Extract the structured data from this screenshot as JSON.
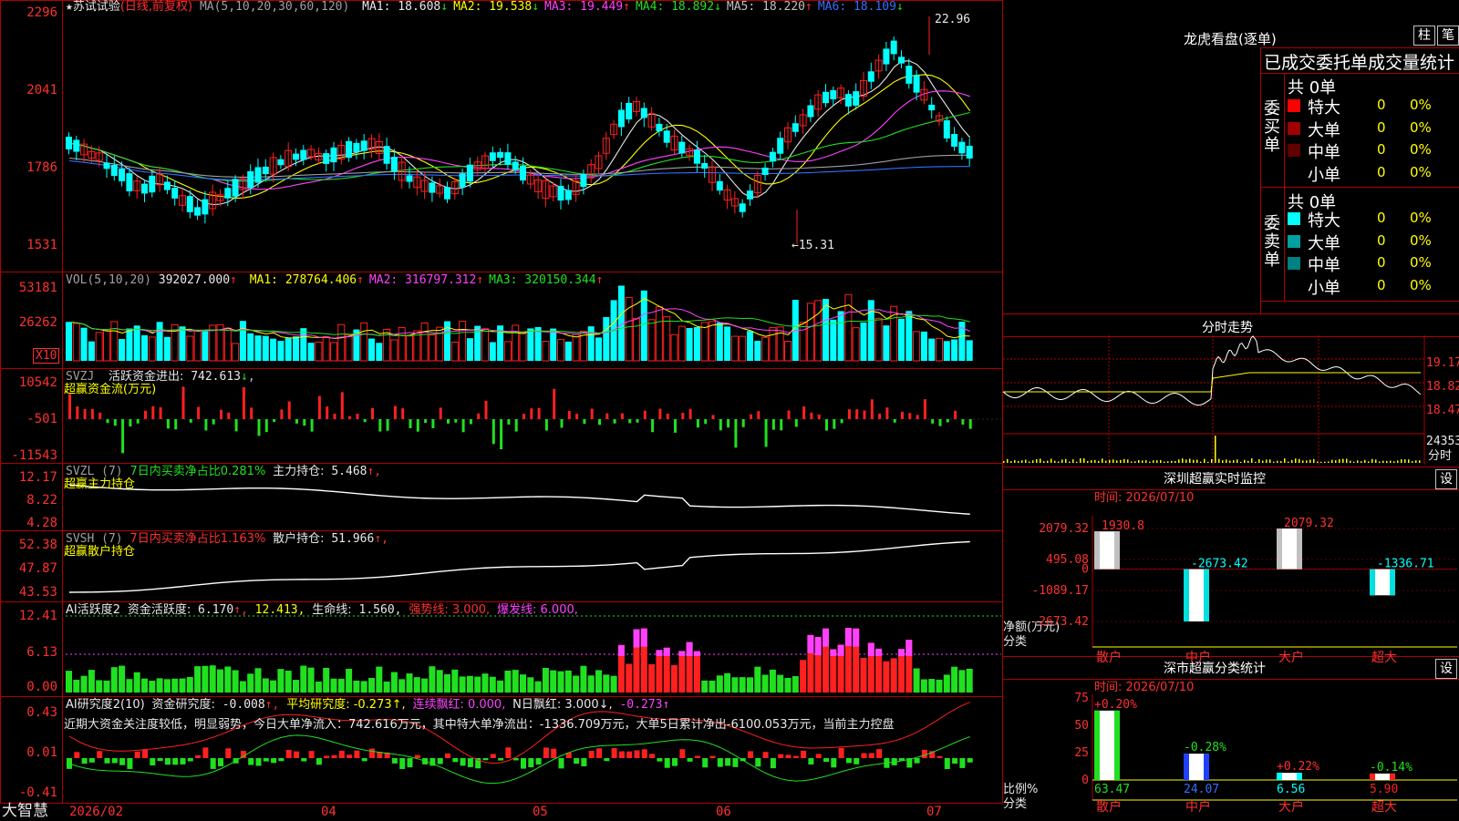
{
  "stock": {
    "name": "苏试试验",
    "mode": "(日线,前复权)"
  },
  "price_header": {
    "ma_def": "MA(5,10,20,30,60,120)",
    "items": [
      {
        "label": "MA1:",
        "value": "18.608",
        "arrow": "↓",
        "color": "#e8e8e8"
      },
      {
        "label": "MA2:",
        "value": "19.538",
        "arrow": "↓",
        "color": "#ffff00"
      },
      {
        "label": "MA3:",
        "value": "19.449",
        "arrow": "↑",
        "color": "#ff40ff"
      },
      {
        "label": "MA4:",
        "value": "18.892",
        "arrow": "↓",
        "color": "#20e020"
      },
      {
        "label": "MA5:",
        "value": "18.220",
        "arrow": "↑",
        "color": "#c0c0c0"
      },
      {
        "label": "MA6:",
        "value": "18.109",
        "arrow": "↓",
        "color": "#3070ff"
      }
    ],
    "high_label": "22.96",
    "low_label": "←15.31",
    "y_ticks": [
      "2296",
      "2041",
      "1786",
      "1531"
    ]
  },
  "vol_panel": {
    "title": "VOL(5,10,20)",
    "value": "392027.000",
    "arrow": "↑",
    "items": [
      {
        "label": "MA1:",
        "value": "278764.406",
        "arrow": "↑",
        "color": "#ffff00"
      },
      {
        "label": "MA2:",
        "value": "316797.312",
        "arrow": "↑",
        "color": "#ff40ff"
      },
      {
        "label": "MA3:",
        "value": "320150.344",
        "arrow": "↑",
        "color": "#20e020"
      }
    ],
    "y_ticks": [
      "53181",
      "26262"
    ],
    "unit": "X10"
  },
  "svzj_panel": {
    "title": "SVZJ",
    "label": "活跃资金进出:",
    "value": "742.613",
    "arrow": "↓",
    "subtitle": "超赢资金流(万元)",
    "y_ticks": [
      "10542",
      "-501",
      "-11543"
    ]
  },
  "svzl_panel": {
    "title": "SVZL (7)",
    "label_a": "7日内买卖净占比0.281%",
    "label_b": "主力持仓:",
    "value": "5.468",
    "arrow": "↑,",
    "subtitle": "超赢主力持仓",
    "y_ticks": [
      "12.17",
      "8.22",
      "4.28"
    ]
  },
  "svsh_panel": {
    "title": "SVSH (7)",
    "label_a": "7日内买卖净占比1.163%",
    "label_b": "散户持仓:",
    "value": "51.966",
    "arrow": "↑,",
    "subtitle": "超赢散户持仓",
    "y_ticks": [
      "52.38",
      "47.87",
      "43.53"
    ]
  },
  "ai_active_panel": {
    "title": "AI活跃度2",
    "label": "资金活跃度:",
    "value": "6.170",
    "arrow": "↑,",
    "v2": "12.413,",
    "life_label": "生命线:",
    "life": "1.560,",
    "strong": "强势线: 3.000,",
    "burst": "爆发线: 6.000,",
    "y_ticks": [
      "12.41",
      "6.13",
      "0.00"
    ]
  },
  "ai_research_panel": {
    "title": "AI研究度2(10)",
    "label": "资金研究度:",
    "value": "-0.008",
    "arrow": "↑,",
    "avg": "平均研究度: -0.273↑,",
    "red": "连续飘红: 0.000,",
    "nred": "N日飘红: 3.000↓,",
    "last": "-0.273↑",
    "summary": "近期大资金关注度较低，明显弱势，今日大单净流入：742.616万元，其中特大单净流出：-1336.709万元，大单5日累计净出-6100.053万元，当前主力控盘",
    "y_ticks": [
      "0.43",
      "0.01",
      "-0.41"
    ]
  },
  "bottom_axis": {
    "brand": "大智慧",
    "dates": [
      "2026/02",
      "04",
      "05",
      "06",
      "07"
    ]
  },
  "longhu": {
    "title": "龙虎看盘(逐单)",
    "tab_a": "柱",
    "tab_b": "笔",
    "header": "已成交委托单成交量统计",
    "buy_label": "委买单",
    "sell_label": "委卖单",
    "buy_total": "共 0单",
    "sell_total": "共 0单",
    "buy_rows": [
      {
        "name": "特大",
        "qty": "0",
        "pct": "0%",
        "color": "#ff0000"
      },
      {
        "name": "大单",
        "qty": "0",
        "pct": "0%",
        "color": "#a00000"
      },
      {
        "name": "中单",
        "qty": "0",
        "pct": "0%",
        "color": "#600000"
      },
      {
        "name": "小单",
        "qty": "0",
        "pct": "0%",
        "color": ""
      }
    ],
    "sell_rows": [
      {
        "name": "特大",
        "qty": "0",
        "pct": "0%",
        "color": "#00ffff"
      },
      {
        "name": "大单",
        "qty": "0",
        "pct": "0%",
        "color": "#00a0a0"
      },
      {
        "name": "中单",
        "qty": "0",
        "pct": "0%",
        "color": "#008080"
      },
      {
        "name": "小单",
        "qty": "0",
        "pct": "0%",
        "color": ""
      }
    ]
  },
  "intraday": {
    "title": "分时走势",
    "prices": [
      "19.17",
      "18.82",
      "18.47"
    ],
    "vol": "24353",
    "vol_unit": "分时"
  },
  "sz_monitor": {
    "title": "深圳超赢实时监控",
    "btn": "设",
    "time_label": "时间: 2026/07/10",
    "y_ticks": [
      "2079.32",
      "495.08",
      "0",
      "-1089.17",
      "-2673.42"
    ],
    "ylabel_a": "净额(万元)",
    "ylabel_b": "分类",
    "categories": [
      "散户",
      "中户",
      "大户",
      "超大"
    ],
    "values": [
      1930.8,
      -2673.42,
      2079.32,
      -1336.71
    ],
    "value_labels": [
      "1930.8",
      "-2673.42",
      "2079.32",
      "-1336.71"
    ]
  },
  "sz_classify": {
    "title": "深市超赢分类统计",
    "btn": "设",
    "time_label": "时间: 2026/07/10",
    "y_ticks": [
      "75",
      "50",
      "25",
      "0"
    ],
    "ylabel_a": "比例%",
    "ylabel_b": "分类",
    "categories": [
      "散户",
      "中户",
      "大户",
      "超大"
    ],
    "ratios": [
      63.47,
      24.07,
      6.56,
      5.9
    ],
    "ratio_labels": [
      "63.47",
      "24.07",
      "6.56",
      "5.90"
    ],
    "changes": [
      "+0.20%",
      "-0.28%",
      "+0.22%",
      "-0.14%"
    ]
  },
  "chart_data": [
    {
      "type": "bar",
      "title": "深圳超赢实时监控",
      "ylabel": "净额(万元)",
      "xlabel": "分类",
      "categories": [
        "散户",
        "中户",
        "大户",
        "超大"
      ],
      "values": [
        1930.8,
        -2673.42,
        2079.32,
        -1336.71
      ],
      "ylim": [
        -2673.42,
        2079.32
      ]
    },
    {
      "type": "bar",
      "title": "深市超赢分类统计",
      "ylabel": "比例%",
      "xlabel": "分类",
      "categories": [
        "散户",
        "中户",
        "大户",
        "超大"
      ],
      "values": [
        63.47,
        24.07,
        6.56,
        5.9
      ],
      "ylim": [
        0,
        75
      ]
    }
  ]
}
